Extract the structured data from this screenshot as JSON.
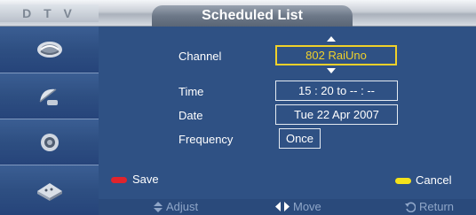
{
  "header": {
    "source": "D T V",
    "title": "Scheduled List"
  },
  "sidebar": {
    "items": [
      {
        "icon": "satellite-dish-icon"
      },
      {
        "icon": "antenna-dish-icon"
      },
      {
        "icon": "gear-icon"
      },
      {
        "icon": "remote-control-icon"
      }
    ]
  },
  "form": {
    "channel": {
      "label": "Channel",
      "value": "802 RaiUno"
    },
    "time": {
      "label": "Time",
      "value": "15 : 20 to -- : --"
    },
    "date": {
      "label": "Date",
      "value": "Tue 22 Apr 2007"
    },
    "frequency": {
      "label": "Frequency",
      "value": "Once"
    }
  },
  "buttons": {
    "save_label": "Save",
    "cancel_label": "Cancel",
    "save_color": "#e0242c",
    "cancel_color": "#f4e21a"
  },
  "hints": {
    "adjust": "Adjust",
    "move": "Move",
    "return": "Return"
  },
  "colors": {
    "accent": "#f0d12a",
    "panel": "#2f5184"
  }
}
